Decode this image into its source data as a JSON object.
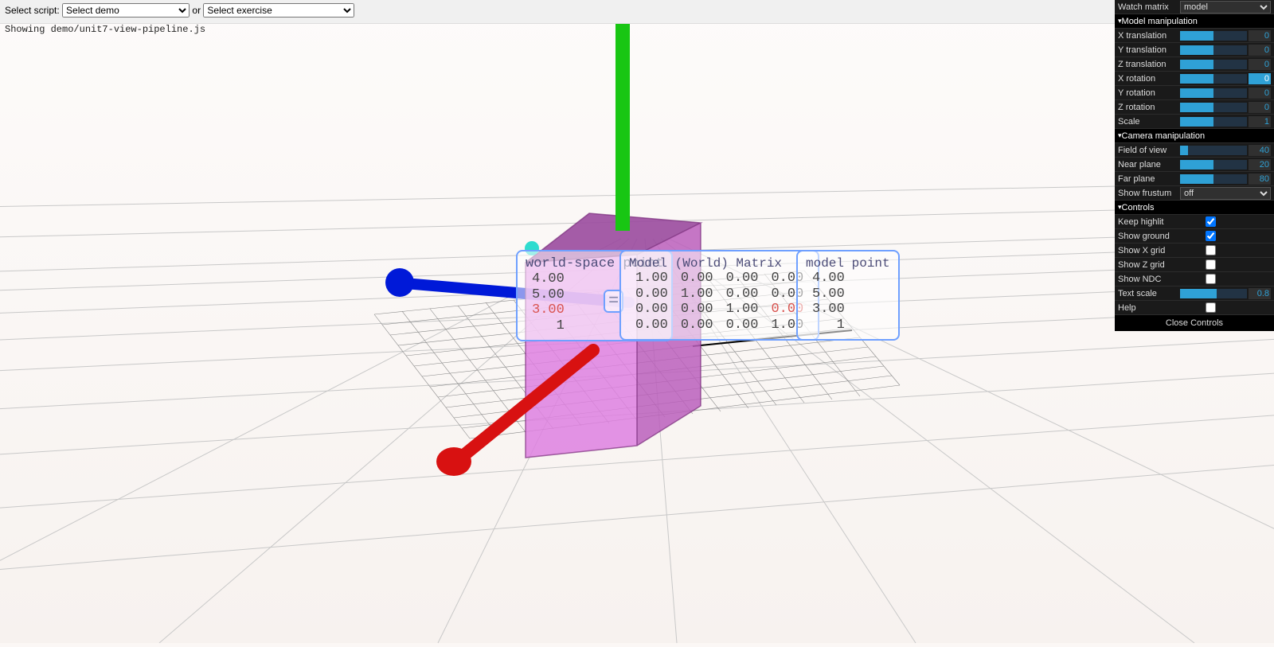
{
  "toolbar": {
    "select_script_label": "Select script:",
    "demo_placeholder": "Select demo",
    "or_label": "or",
    "exercise_placeholder": "Select exercise"
  },
  "status_line": "Showing demo/unit7-view-pipeline.js",
  "panels": {
    "world_space": {
      "title": "world-space point",
      "rows": [
        "4.00",
        "5.00",
        "3.00",
        "1"
      ],
      "highlight_index": 2
    },
    "model_matrix": {
      "title": "Model (World) Matrix",
      "rows": [
        [
          "1.00",
          "0.00",
          "0.00",
          "0.00"
        ],
        [
          "0.00",
          "1.00",
          "0.00",
          "0.00"
        ],
        [
          "0.00",
          "0.00",
          "1.00",
          "0.00"
        ],
        [
          "0.00",
          "0.00",
          "0.00",
          "1.00"
        ]
      ],
      "highlight": {
        "row": 2,
        "col": 3
      }
    },
    "model_point": {
      "title": "model point",
      "rows": [
        "4.00",
        "5.00",
        "3.00",
        "1"
      ]
    },
    "equals": "="
  },
  "gui": {
    "watch_matrix_label": "Watch matrix",
    "watch_matrix_value": "model",
    "sections": {
      "model": "Model manipulation",
      "camera": "Camera manipulation",
      "controls": "Controls"
    },
    "sliders": {
      "x_translation": {
        "label": "X translation",
        "value": "0",
        "fill": 50
      },
      "y_translation": {
        "label": "Y translation",
        "value": "0",
        "fill": 50
      },
      "z_translation": {
        "label": "Z translation",
        "value": "0",
        "fill": 50
      },
      "x_rotation": {
        "label": "X rotation",
        "value": "0",
        "fill": 50,
        "valuehl": true
      },
      "y_rotation": {
        "label": "Y rotation",
        "value": "0",
        "fill": 50
      },
      "z_rotation": {
        "label": "Z rotation",
        "value": "0",
        "fill": 50
      },
      "scale": {
        "label": "Scale",
        "value": "1",
        "fill": 50
      },
      "fov": {
        "label": "Field of view",
        "value": "40",
        "fill": 12
      },
      "near": {
        "label": "Near plane",
        "value": "20",
        "fill": 50
      },
      "far": {
        "label": "Far plane",
        "value": "80",
        "fill": 50
      },
      "text_scale": {
        "label": "Text scale",
        "value": "0.8",
        "fill": 55
      }
    },
    "show_frustum_label": "Show frustum",
    "show_frustum_value": "off",
    "checks": {
      "keep_highlit": {
        "label": "Keep highlit",
        "value": true
      },
      "show_ground": {
        "label": "Show ground",
        "value": true
      },
      "show_x_grid": {
        "label": "Show X grid",
        "value": false
      },
      "show_z_grid": {
        "label": "Show Z grid",
        "value": false
      },
      "show_ndc": {
        "label": "Show NDC",
        "value": false
      },
      "help": {
        "label": "Help",
        "value": false
      }
    },
    "close": "Close Controls"
  }
}
